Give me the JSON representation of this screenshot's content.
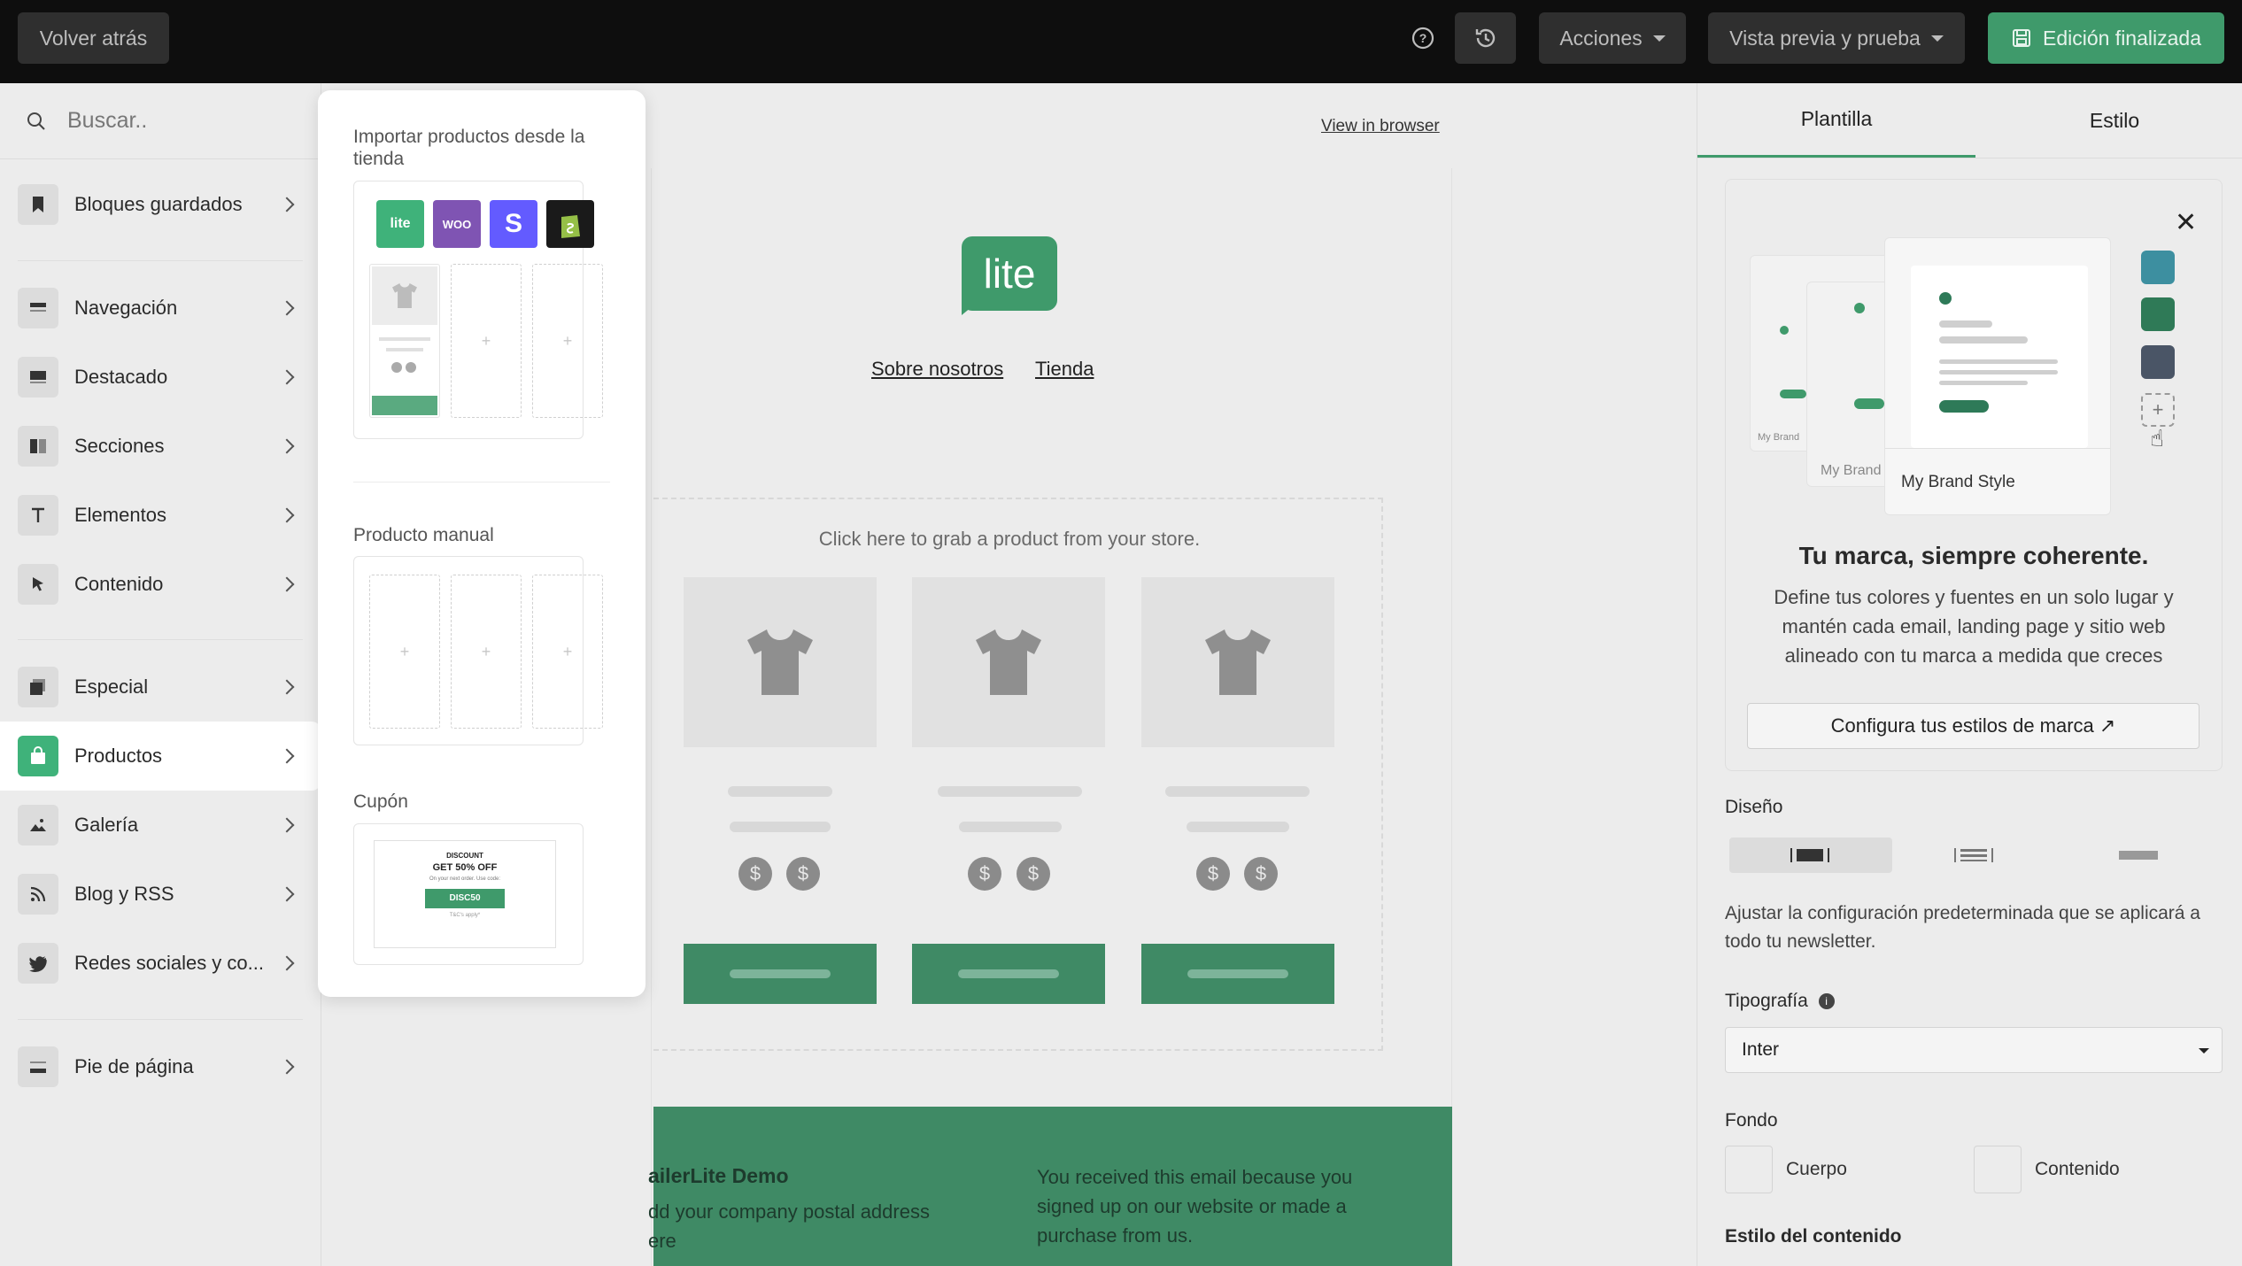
{
  "topbar": {
    "back_label": "Volver atrás",
    "actions_label": "Acciones",
    "preview_label": "Vista previa y prueba",
    "done_label": "Edición finalizada",
    "accent_color": "#3f9a6b"
  },
  "sidebar": {
    "search_placeholder": "Buscar..",
    "items": [
      {
        "label": "Bloques guardados",
        "icon": "bookmark-icon"
      },
      {
        "label": "Navegación",
        "icon": "navigation-icon"
      },
      {
        "label": "Destacado",
        "icon": "featured-icon"
      },
      {
        "label": "Secciones",
        "icon": "sections-icon"
      },
      {
        "label": "Elementos",
        "icon": "text-icon"
      },
      {
        "label": "Contenido",
        "icon": "cursor-icon"
      },
      {
        "label": "Especial",
        "icon": "special-icon"
      },
      {
        "label": "Productos",
        "icon": "shopping-bag-icon"
      },
      {
        "label": "Galería",
        "icon": "gallery-icon"
      },
      {
        "label": "Blog y RSS",
        "icon": "rss-icon"
      },
      {
        "label": "Redes sociales y co...",
        "icon": "twitter-icon"
      },
      {
        "label": "Pie de página",
        "icon": "footer-icon"
      }
    ]
  },
  "flyout": {
    "import_title": "Importar productos desde la tienda",
    "store_logos": [
      "lite",
      "WOO",
      "S",
      "shopify"
    ],
    "manual_title": "Producto manual",
    "coupon_title": "Cupón",
    "coupon": {
      "label": "DISCOUNT",
      "headline": "GET 50% OFF",
      "sub": "On your next order. Use code:",
      "code": "DISC50",
      "terms": "T&C's apply*"
    }
  },
  "canvas": {
    "view_in_browser": "View in browser",
    "logo_text": "lite",
    "nav": [
      "Sobre nosotros",
      "Tienda"
    ],
    "product_hint": "Click here to grab a product from your store.",
    "footer_title": "ailerLite Demo",
    "footer_address_line1": "dd your company postal address",
    "footer_address_line2": "ere",
    "footer_note": "You received this email because you signed up on our website or made a purchase from us."
  },
  "right_panel": {
    "tabs": [
      "Plantilla",
      "Estilo"
    ],
    "brand_mock_labels": [
      "My Brand",
      "My Brand",
      "My Brand Style"
    ],
    "brand_heading": "Tu marca, siempre coherente.",
    "brand_body": "Define tus colores y fuentes en un solo lugar y mantén cada email, landing page y sitio web alineado con tu marca a medida que creces",
    "brand_button": "Configura tus estilos de marca ↗",
    "swatches": [
      "#3d8fa0",
      "#2f7a57",
      "#4a5566"
    ],
    "layout_title": "Diseño",
    "layout_hint": "Ajustar la configuración predeterminada que se aplicará a todo tu newsletter.",
    "typography_title": "Tipografía",
    "typography_value": "Inter",
    "background_title": "Fondo",
    "background_body": "Cuerpo",
    "background_content": "Contenido",
    "content_style_title": "Estilo del contenido"
  }
}
